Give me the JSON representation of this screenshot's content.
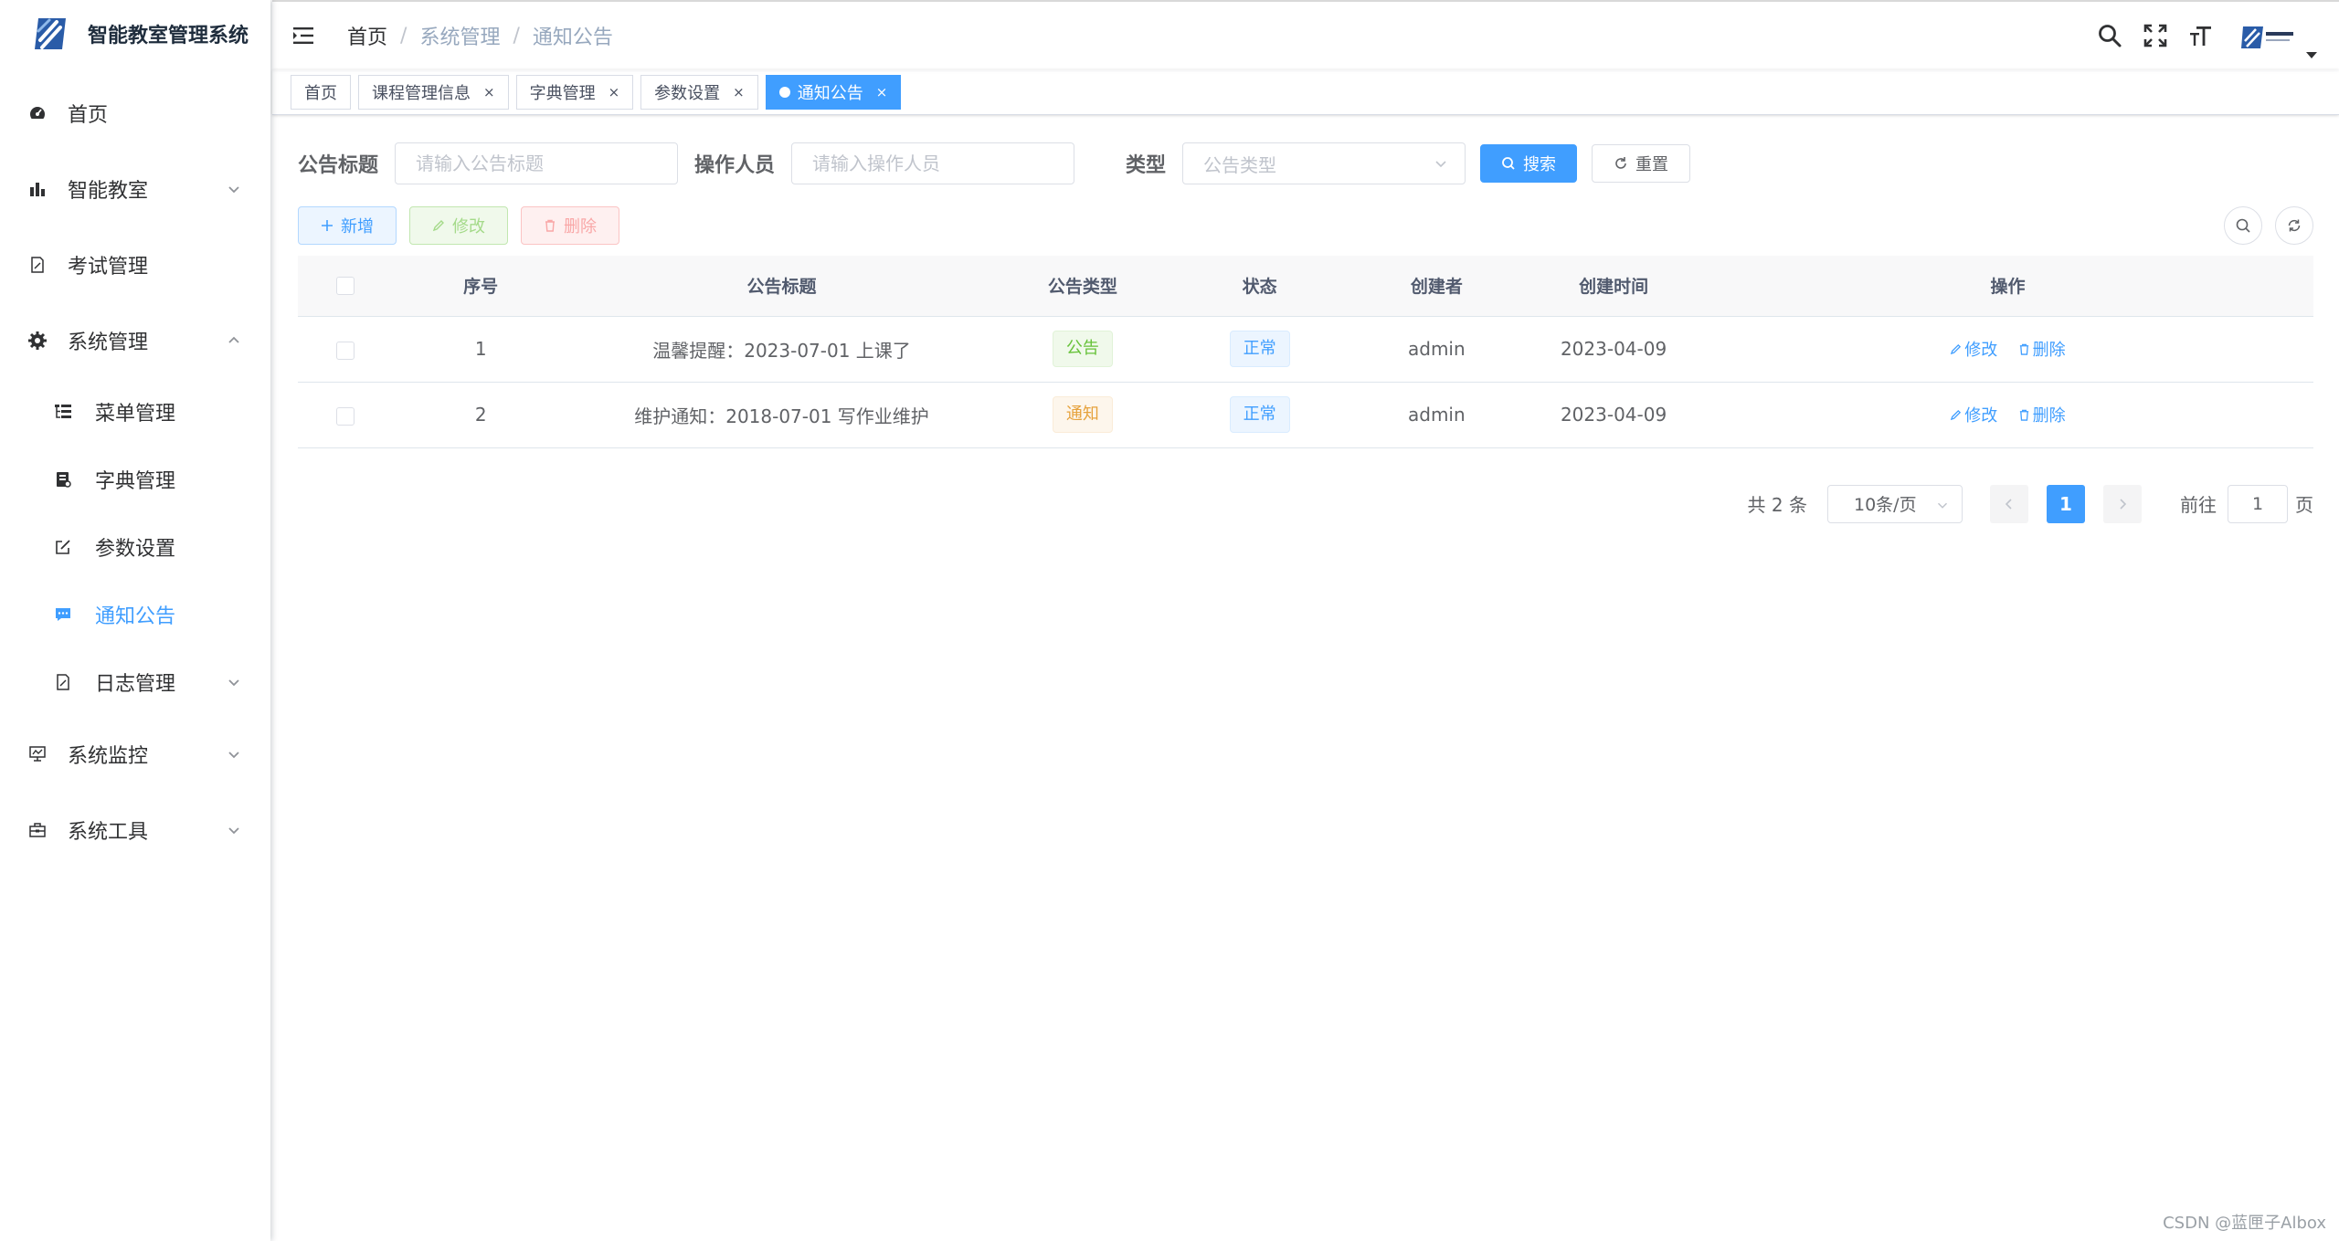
{
  "app": {
    "title": "智能教室管理系统"
  },
  "sidebar": {
    "items": [
      {
        "label": "首页"
      },
      {
        "label": "智能教室"
      },
      {
        "label": "考试管理"
      },
      {
        "label": "系统管理"
      },
      {
        "label": "菜单管理"
      },
      {
        "label": "字典管理"
      },
      {
        "label": "参数设置"
      },
      {
        "label": "通知公告"
      },
      {
        "label": "日志管理"
      },
      {
        "label": "系统监控"
      },
      {
        "label": "系统工具"
      }
    ]
  },
  "breadcrumb": [
    "首页",
    "系统管理",
    "通知公告"
  ],
  "tags": [
    {
      "label": "首页"
    },
    {
      "label": "课程管理信息",
      "close": "×"
    },
    {
      "label": "字典管理",
      "close": "×"
    },
    {
      "label": "参数设置",
      "close": "×"
    },
    {
      "label": "通知公告",
      "close": "×"
    }
  ],
  "search": {
    "title_label": "公告标题",
    "title_placeholder": "请输入公告标题",
    "operator_label": "操作人员",
    "operator_placeholder": "请输入操作人员",
    "type_label": "类型",
    "type_placeholder": "公告类型",
    "search_btn": "搜索",
    "reset_btn": "重置"
  },
  "toolbar": {
    "add": "新增",
    "edit": "修改",
    "delete": "删除"
  },
  "table": {
    "headers": [
      "序号",
      "公告标题",
      "公告类型",
      "状态",
      "创建者",
      "创建时间",
      "操作"
    ],
    "rows": [
      {
        "id": "1",
        "title": "温馨提醒：2023-07-01 上课了",
        "type": "公告",
        "status": "正常",
        "creator": "admin",
        "time": "2023-04-09",
        "edit": "修改",
        "delete": "删除"
      },
      {
        "id": "2",
        "title": "维护通知：2018-07-01 写作业维护",
        "type": "通知",
        "status": "正常",
        "creator": "admin",
        "time": "2023-04-09",
        "edit": "修改",
        "delete": "删除"
      }
    ]
  },
  "pagination": {
    "total": "共 2 条",
    "page_size": "10条/页",
    "current": "1",
    "goto": "前往",
    "goto_value": "1",
    "unit": "页"
  },
  "watermark": "CSDN @蓝匣子Albox",
  "colors": {
    "primary": "#409eff",
    "success": "#67c23a",
    "warning": "#e6a23c",
    "danger": "#f56c6c"
  }
}
